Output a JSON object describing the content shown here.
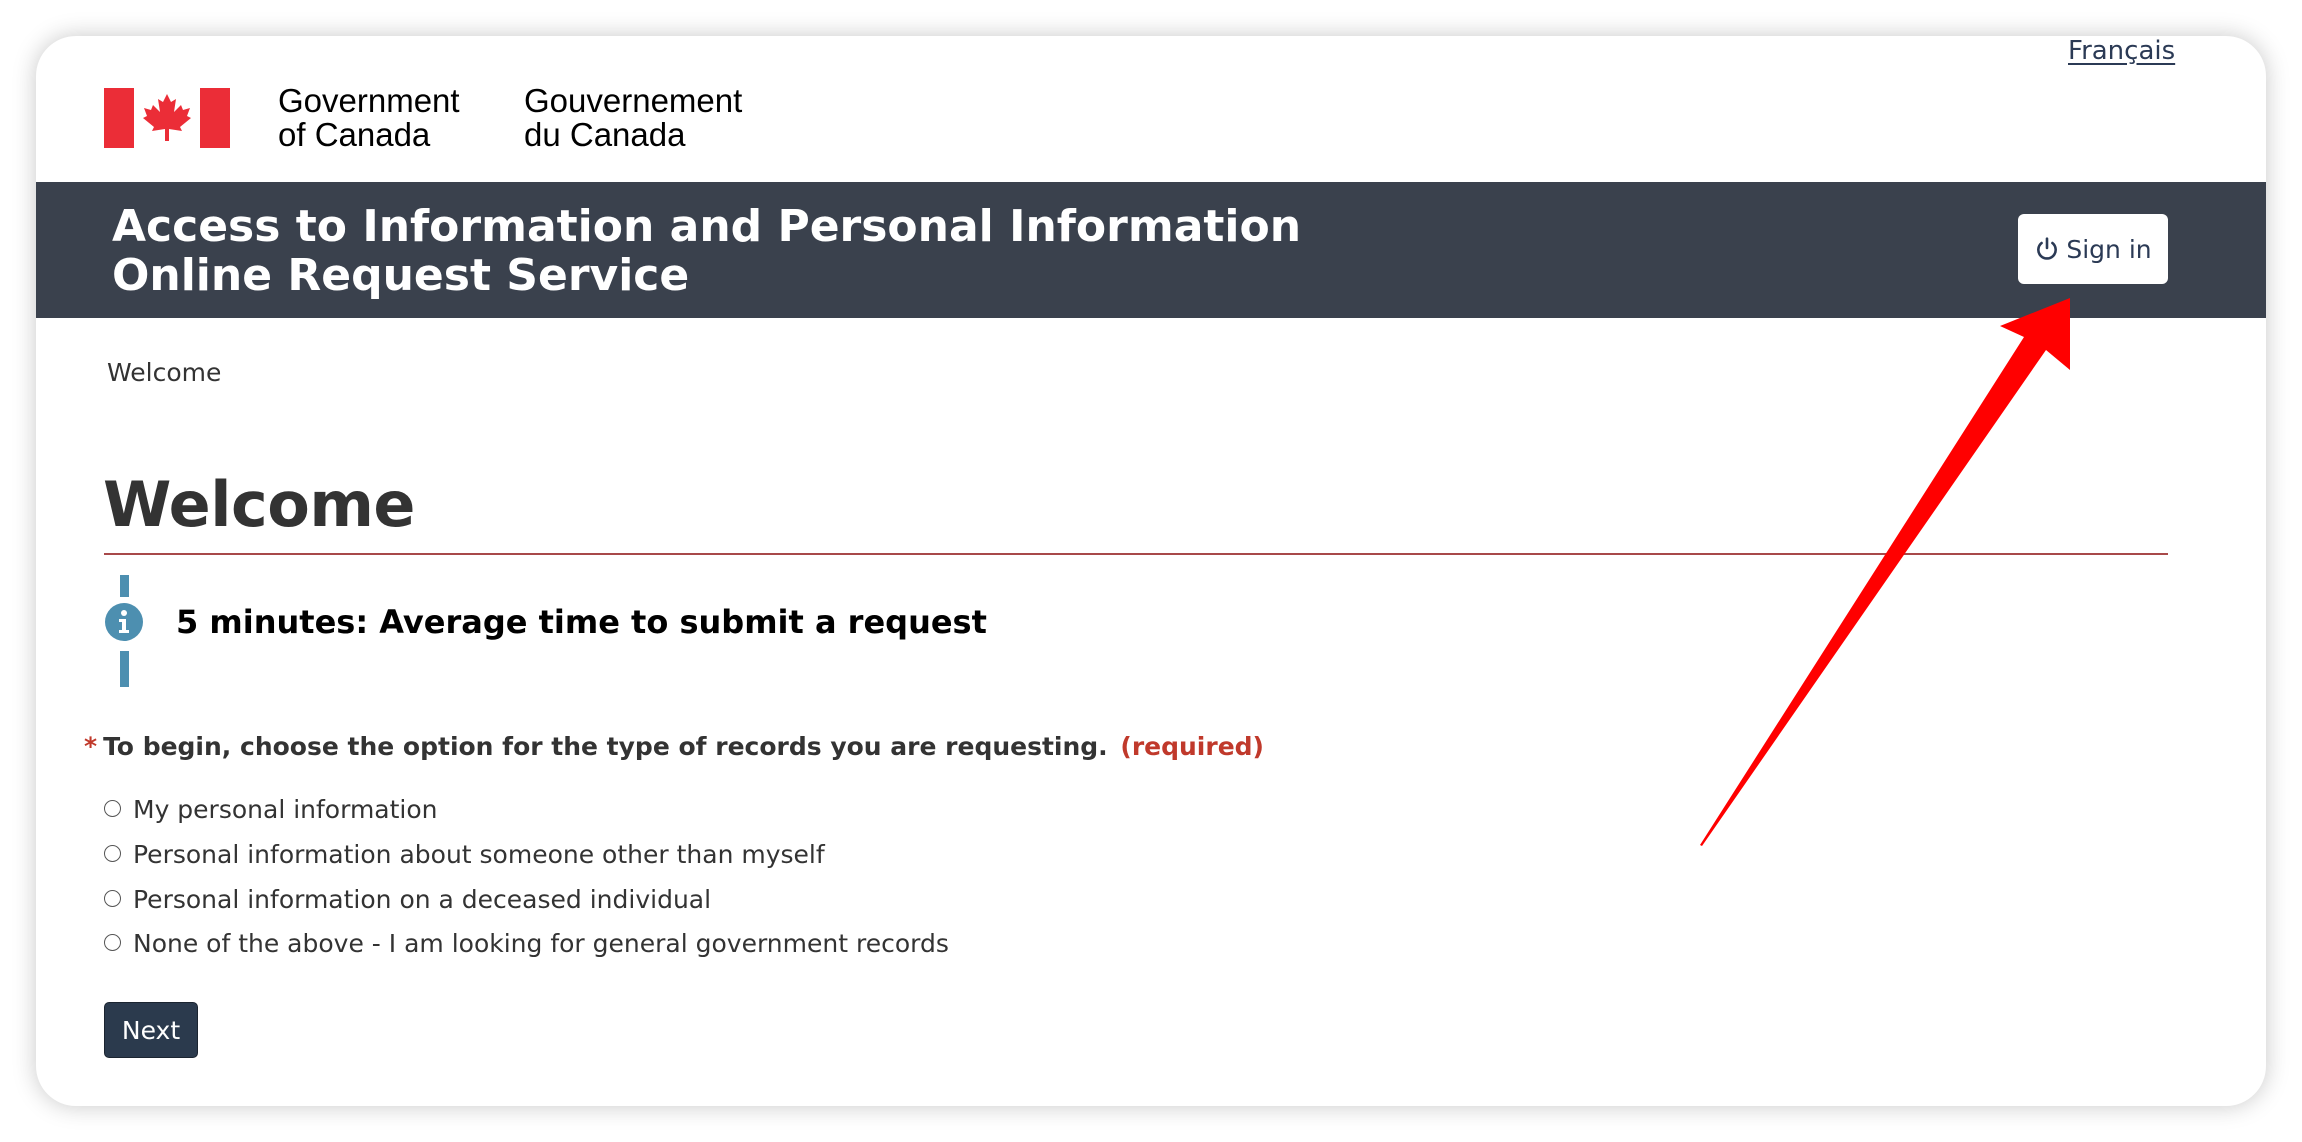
{
  "header": {
    "language_link": "Français",
    "gov_en_line1": "Government",
    "gov_en_line2": "of Canada",
    "gov_fr_line1": "Gouvernement",
    "gov_fr_line2": "du Canada"
  },
  "banner": {
    "title_line1": "Access to Information and Personal Information",
    "title_line2": "Online Request Service",
    "signin_label": "Sign in",
    "background_color": "#3a414d"
  },
  "breadcrumb": {
    "current": "Welcome"
  },
  "main": {
    "title": "Welcome",
    "info_text": "5 minutes: Average time to submit a request",
    "question": {
      "required_marker": "*",
      "label": "To begin, choose the option for the type of records you are requesting.",
      "required_tag": "(required)",
      "options": [
        {
          "label": "My personal information",
          "selected": false
        },
        {
          "label": "Personal information about someone other than myself",
          "selected": false
        },
        {
          "label": "Personal information on a deceased individual",
          "selected": false
        },
        {
          "label": "None of the above - I am looking for general government records",
          "selected": false
        }
      ]
    },
    "next_label": "Next"
  },
  "colors": {
    "flag_red": "#eb2d37",
    "accent_info": "#4d8fb0",
    "required_red": "#c0392b",
    "arrow_red": "#ff0000"
  }
}
